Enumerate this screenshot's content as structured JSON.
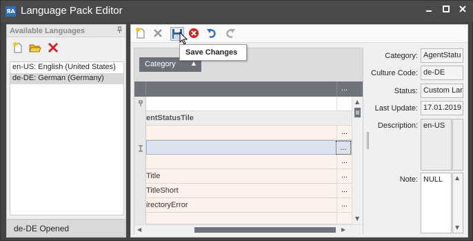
{
  "window": {
    "icon_text": "ЯA",
    "title": "Language Pack Editor"
  },
  "left_panel": {
    "title": "Available Languages",
    "languages": [
      "en-US: English (United States)",
      "de-DE: German (Germany)"
    ],
    "status": "de-DE Opened"
  },
  "toolbar": {
    "tooltip": "Save Changes"
  },
  "grid": {
    "group_button": "Category",
    "group_row": "entStatusTile",
    "dots": "...",
    "rows": [
      "",
      "",
      "",
      "Title",
      "TitleShort",
      "irectoryError",
      ""
    ]
  },
  "details": {
    "category_label": "Category:",
    "category_value": "AgentStatu",
    "culture_label": "Culture Code:",
    "culture_value": "de-DE",
    "status_label": "Status:",
    "status_value": "Custom Lar",
    "update_label": "Last Update:",
    "update_value": "17.01.2019",
    "description_label": "Description:",
    "description_value": "en-US",
    "note_label": "Note:",
    "note_value": "NULL"
  },
  "colors": {
    "title_bar": "#4a4a4a",
    "header_grey": "#6e737c",
    "delete_red": "#d42020",
    "folder_yellow": "#e8b020"
  }
}
